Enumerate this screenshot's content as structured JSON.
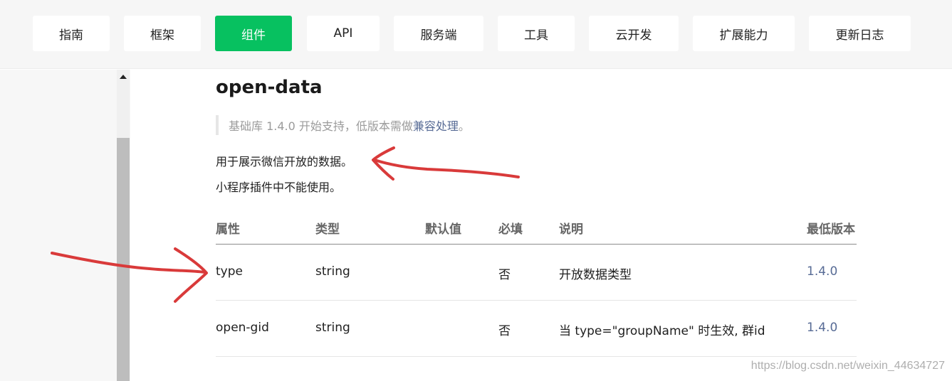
{
  "nav": {
    "tabs": [
      {
        "label": "指南",
        "active": false
      },
      {
        "label": "框架",
        "active": false
      },
      {
        "label": "组件",
        "active": true
      },
      {
        "label": "API",
        "active": false
      },
      {
        "label": "服务端",
        "active": false
      },
      {
        "label": "工具",
        "active": false
      },
      {
        "label": "云开发",
        "active": false
      },
      {
        "label": "扩展能力",
        "active": false
      },
      {
        "label": "更新日志",
        "active": false
      }
    ]
  },
  "content": {
    "title": "open-data",
    "note": {
      "prefix": "基础库 1.4.0 开始支持，低版本需做",
      "link": "兼容处理",
      "suffix": "。"
    },
    "desc1": "用于展示微信开放的数据。",
    "desc2": "小程序插件中不能使用。"
  },
  "table": {
    "headers": {
      "attr": "属性",
      "type": "类型",
      "default": "默认值",
      "required": "必填",
      "desc": "说明",
      "version": "最低版本"
    },
    "rows": [
      {
        "attr": "type",
        "type": "string",
        "default": "",
        "required": "否",
        "desc": "开放数据类型",
        "version": "1.4.0"
      },
      {
        "attr": "open-gid",
        "type": "string",
        "default": "",
        "required": "否",
        "desc": "当 type=\"groupName\" 时生效, 群id",
        "version": "1.4.0"
      }
    ]
  },
  "watermark": "https://blog.csdn.net/weixin_44634727",
  "colors": {
    "accent": "#07c160",
    "link": "#576b95",
    "annotation": "#d93a3a"
  }
}
